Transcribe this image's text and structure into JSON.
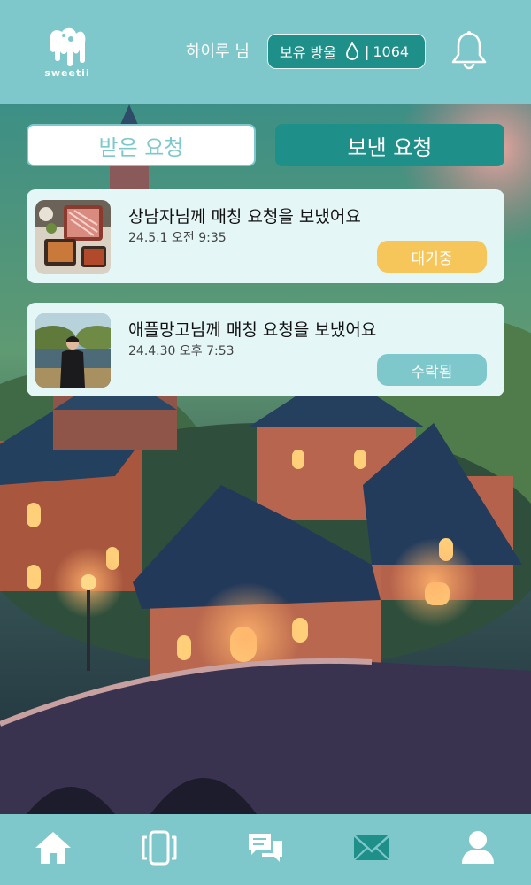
{
  "app": {
    "logo_text": "sweetii"
  },
  "header": {
    "greeting": "하이루 님",
    "drops_label": "보유 방울",
    "drops_separator": "|",
    "drops_count": "1064"
  },
  "tabs": [
    {
      "label": "받은 요청",
      "active": false
    },
    {
      "label": "보낸 요청",
      "active": true
    }
  ],
  "requests": [
    {
      "message": "상남자님께 매칭 요청을 보냈어요",
      "time": "24.5.1 오전 9:35",
      "status": "대기중",
      "status_color": "#f7c65a"
    },
    {
      "message": "애플망고님께 매칭 요청을 보냈어요",
      "time": "24.4.30 오후 7:53",
      "status": "수락됨",
      "status_color": "#7ec8cc"
    }
  ],
  "nav": [
    {
      "icon": "home-icon"
    },
    {
      "icon": "cards-icon"
    },
    {
      "icon": "chat-icon"
    },
    {
      "icon": "mail-icon"
    },
    {
      "icon": "profile-icon"
    }
  ],
  "colors": {
    "header_bg": "#7ec8cc",
    "accent_dark": "#1f8f8a",
    "card_bg": "#e4f6f6",
    "waiting": "#f7c65a",
    "accepted": "#7ec8cc"
  }
}
